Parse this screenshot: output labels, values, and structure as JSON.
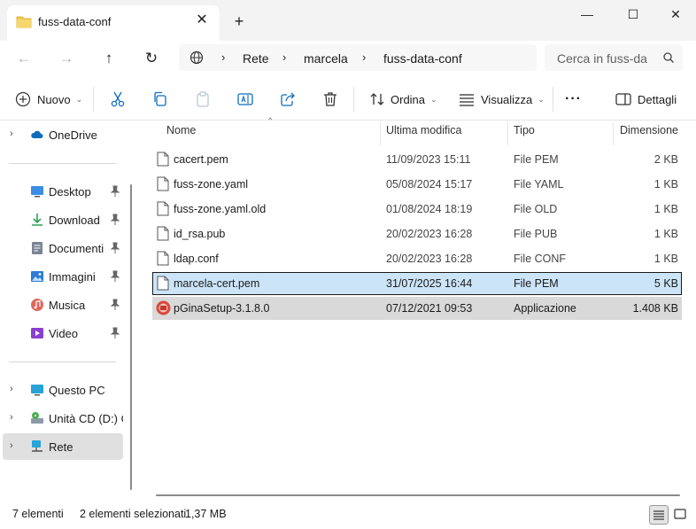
{
  "window": {
    "tab_title": "fuss-data-conf",
    "close_tab_icon": "close-icon",
    "new_tab_label": "+"
  },
  "nav": {
    "breadcrumbs": [
      "Rete",
      "marcela",
      "fuss-data-conf"
    ],
    "search_placeholder": "Cerca in fuss-da"
  },
  "toolbar": {
    "new_label": "Nuovo",
    "sort_label": "Ordina",
    "view_label": "Visualizza",
    "more_label": "···",
    "details_label": "Dettagli"
  },
  "sidebar": {
    "items": [
      {
        "label": "OneDrive",
        "icon": "cloud-icon"
      },
      {
        "label": "Desktop",
        "icon": "desktop-icon"
      },
      {
        "label": "Download",
        "icon": "download-icon"
      },
      {
        "label": "Documenti",
        "icon": "documents-icon"
      },
      {
        "label": "Immagini",
        "icon": "pictures-icon"
      },
      {
        "label": "Musica",
        "icon": "music-icon"
      },
      {
        "label": "Video",
        "icon": "video-icon"
      },
      {
        "label": "Questo PC",
        "icon": "computer-icon"
      },
      {
        "label": "Unità CD (D:) CC",
        "icon": "cd-drive-icon"
      },
      {
        "label": "Rete",
        "icon": "network-icon"
      }
    ]
  },
  "table": {
    "columns": [
      "Nome",
      "Ultima modifica",
      "Tipo",
      "Dimensione"
    ],
    "rows": [
      {
        "name": "cacert.pem",
        "modified": "11/09/2023 15:11",
        "type": "File PEM",
        "size": "2 KB"
      },
      {
        "name": "fuss-zone.yaml",
        "modified": "05/08/2024 15:17",
        "type": "File YAML",
        "size": "1 KB"
      },
      {
        "name": "fuss-zone.yaml.old",
        "modified": "01/08/2024 18:19",
        "type": "File OLD",
        "size": "1 KB"
      },
      {
        "name": "id_rsa.pub",
        "modified": "20/02/2023 16:28",
        "type": "File PUB",
        "size": "1 KB"
      },
      {
        "name": "ldap.conf",
        "modified": "20/02/2023 16:28",
        "type": "File CONF",
        "size": "1 KB"
      },
      {
        "name": "marcela-cert.pem",
        "modified": "31/07/2025 16:44",
        "type": "File PEM",
        "size": "5 KB"
      },
      {
        "name": "pGinaSetup-3.1.8.0",
        "modified": "07/12/2021 09:53",
        "type": "Applicazione",
        "size": "1.408 KB"
      }
    ]
  },
  "status": {
    "count": "7 elementi",
    "selection": "2 elementi selezionati",
    "size": "1,37 MB"
  },
  "colors": {
    "selection": "#cce4f7",
    "folder": "#f2c94c",
    "onedrive": "#0f6cbd"
  }
}
